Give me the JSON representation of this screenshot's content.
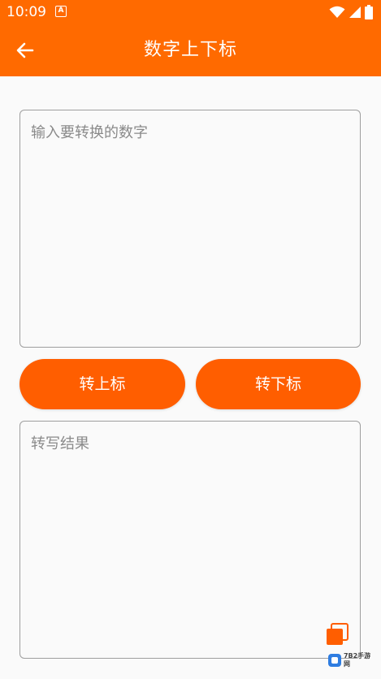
{
  "status_bar": {
    "time": "10:09",
    "notification_badge": "A",
    "icons": [
      "wifi-icon",
      "signal-icon",
      "battery-icon"
    ]
  },
  "app_bar": {
    "title": "数字上下标",
    "back_icon": "arrow-left-icon"
  },
  "input": {
    "placeholder": "输入要转换的数字",
    "value": ""
  },
  "buttons": {
    "superscript_label": "转上标",
    "subscript_label": "转下标"
  },
  "output": {
    "placeholder": "转写结果",
    "value": ""
  },
  "copy_icon": "copy-icon",
  "watermark": {
    "text": "7B2手游网"
  },
  "colors": {
    "accent": "#ff6a00",
    "button": "#ff5e00",
    "background": "#fafafa",
    "border": "#9e9e9e"
  }
}
